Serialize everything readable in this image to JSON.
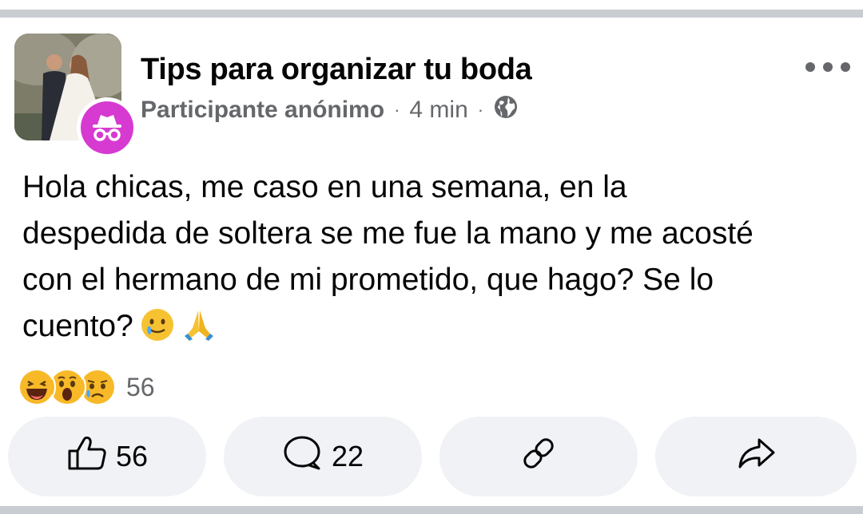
{
  "post": {
    "group_name": "Tips para organizar tu boda",
    "author": "Participante anónimo",
    "separator": "·",
    "time": "4 min",
    "privacy_icon": "globe-icon",
    "text_lines": [
      "Hola chicas, me caso en una semana, en la",
      "despedida de soltera se me fue la mano y me acosté",
      "con el hermano de mi prometido, que hago? Se lo",
      "cuento?"
    ],
    "emojis": [
      "smiling-face-with-tear",
      "folded-hands"
    ]
  },
  "reactions": {
    "types": [
      "haha",
      "wow",
      "sad"
    ],
    "count": "56"
  },
  "actions": {
    "like_count": "56",
    "comment_count": "22",
    "link_icon": "link-icon",
    "share_icon": "share-icon"
  },
  "colors": {
    "anon_badge": "#d63ad1",
    "secondary_text": "#65676b",
    "action_bg": "#f0f2f5",
    "reaction_yellow": "#f7b928"
  }
}
